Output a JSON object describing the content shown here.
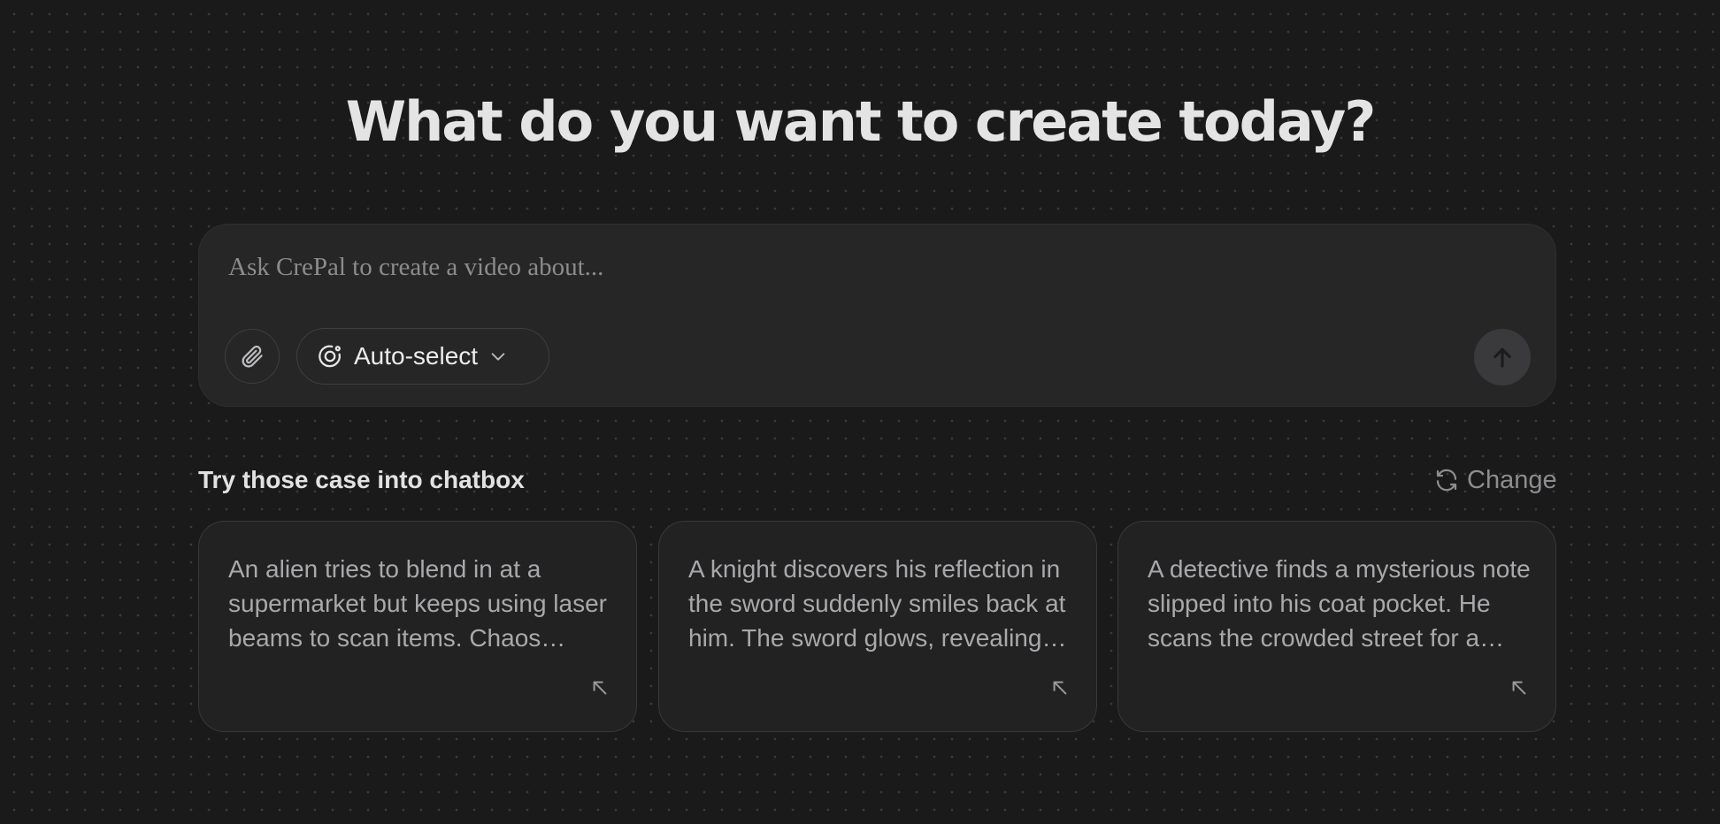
{
  "headline": "What do you want to create today?",
  "chatbox": {
    "placeholder": "Ask CrePal to create a video about...",
    "model_select_label": "Auto-select"
  },
  "suggestions": {
    "title": "Try those case into chatbox",
    "change_label": "Change",
    "cards": [
      {
        "text": "An alien tries to blend in at a supermarket but keeps using laser beams to scan items. Chaos ensues as the cashier reacts."
      },
      {
        "text": "A knight discovers his reflection in the sword suddenly smiles back at him. The sword glows, revealing a hidden destiny."
      },
      {
        "text": "A detective finds a mysterious note slipped into his coat pocket. He scans the crowded street for a suspect."
      }
    ]
  },
  "icons": {
    "attach": "paperclip-icon",
    "model": "target-icon",
    "dropdown": "chevron-down-icon",
    "send": "arrow-up-icon",
    "change": "refresh-icon",
    "card_arrow": "arrow-up-left-icon"
  },
  "colors": {
    "background": "#1a1a1b",
    "chatbox": "#262627",
    "card": "#222223",
    "send_button": "#3a3a3c"
  }
}
